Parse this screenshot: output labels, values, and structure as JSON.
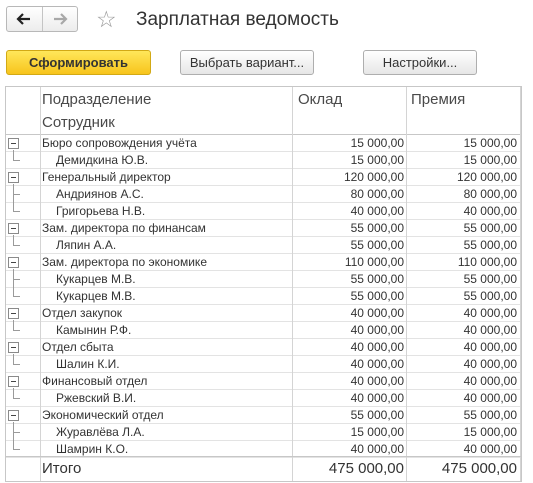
{
  "window": {
    "title": "Зарплатная ведомость",
    "back_icon": "arrow-left-icon",
    "forward_icon": "arrow-right-icon",
    "favorite_icon": "star-icon"
  },
  "toolbar": {
    "generate_label": "Сформировать",
    "variant_label": "Выбрать вариант...",
    "settings_label": "Настройки..."
  },
  "table": {
    "headers": {
      "department": "Подразделение",
      "employee": "Сотрудник",
      "salary": "Оклад",
      "bonus": "Премия"
    },
    "groups": [
      {
        "name": "Бюро сопровождения учёта",
        "salary": "15 000,00",
        "bonus": "15 000,00",
        "employees": [
          {
            "name": "Демидкина Ю.В.",
            "salary": "15 000,00",
            "bonus": "15 000,00"
          }
        ]
      },
      {
        "name": "Генеральный директор",
        "salary": "120 000,00",
        "bonus": "120 000,00",
        "employees": [
          {
            "name": "Андриянов А.С.",
            "salary": "80 000,00",
            "bonus": "80 000,00"
          },
          {
            "name": "Григорьева Н.В.",
            "salary": "40 000,00",
            "bonus": "40 000,00"
          }
        ]
      },
      {
        "name": "Зам. директора по финансам",
        "salary": "55 000,00",
        "bonus": "55 000,00",
        "employees": [
          {
            "name": "Ляпин А.А.",
            "salary": "55 000,00",
            "bonus": "55 000,00"
          }
        ]
      },
      {
        "name": "Зам. директора по экономике",
        "salary": "110 000,00",
        "bonus": "110 000,00",
        "employees": [
          {
            "name": "Кукарцев М.В.",
            "salary": "55 000,00",
            "bonus": "55 000,00"
          },
          {
            "name": "Кукарцев М.В.",
            "salary": "55 000,00",
            "bonus": "55 000,00"
          }
        ]
      },
      {
        "name": "Отдел закупок",
        "salary": "40 000,00",
        "bonus": "40 000,00",
        "employees": [
          {
            "name": "Камынин Р.Ф.",
            "salary": "40 000,00",
            "bonus": "40 000,00"
          }
        ]
      },
      {
        "name": "Отдел сбыта",
        "salary": "40 000,00",
        "bonus": "40 000,00",
        "employees": [
          {
            "name": "Шалин К.И.",
            "salary": "40 000,00",
            "bonus": "40 000,00"
          }
        ]
      },
      {
        "name": "Финансовый отдел",
        "salary": "40 000,00",
        "bonus": "40 000,00",
        "employees": [
          {
            "name": "Ржевский В.И.",
            "salary": "40 000,00",
            "bonus": "40 000,00"
          }
        ]
      },
      {
        "name": "Экономический отдел",
        "salary": "55 000,00",
        "bonus": "55 000,00",
        "employees": [
          {
            "name": "Журавлёва Л.А.",
            "salary": "15 000,00",
            "bonus": "15 000,00"
          },
          {
            "name": "Шамрин К.О.",
            "salary": "40 000,00",
            "bonus": "40 000,00"
          }
        ]
      }
    ],
    "total": {
      "label": "Итого",
      "salary": "475 000,00",
      "bonus": "475 000,00"
    }
  }
}
